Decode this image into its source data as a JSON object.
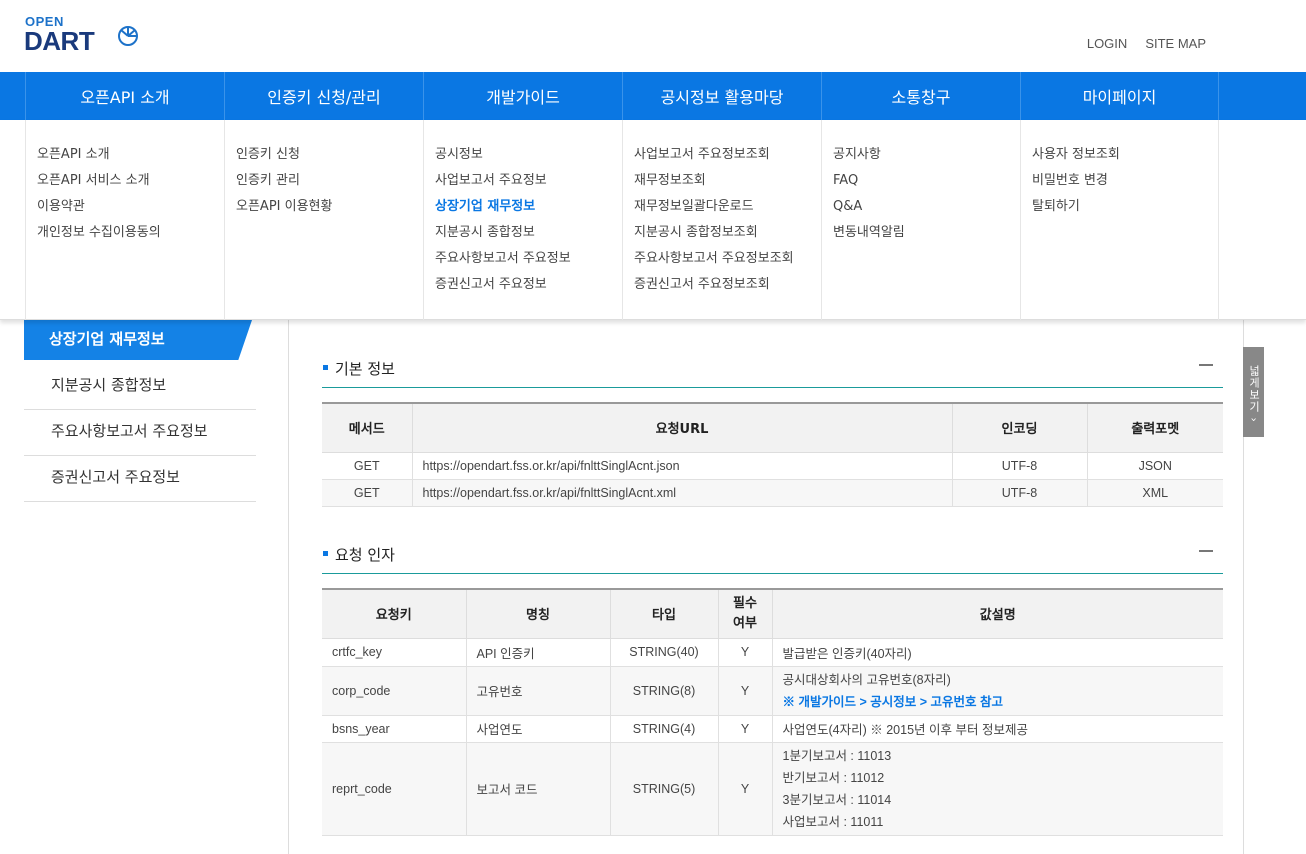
{
  "logo": {
    "top": "OPEN",
    "main": "DART"
  },
  "util": {
    "login": "LOGIN",
    "sitemap": "SITE MAP"
  },
  "gnb": [
    "오픈API 소개",
    "인증키 신청/관리",
    "개발가이드",
    "공시정보 활용마당",
    "소통창구",
    "마이페이지"
  ],
  "mega": [
    [
      "오픈API 소개",
      "오픈API 서비스 소개",
      "이용약관",
      "개인정보 수집이용동의"
    ],
    [
      "인증키 신청",
      "인증키 관리",
      "오픈API 이용현황"
    ],
    [
      "공시정보",
      "사업보고서 주요정보",
      "상장기업 재무정보",
      "지분공시 종합정보",
      "주요사항보고서 주요정보",
      "증권신고서 주요정보"
    ],
    [
      "사업보고서 주요정보조회",
      "재무정보조회",
      "재무정보일괄다운로드",
      "지분공시 종합정보조회",
      "주요사항보고서 주요정보조회",
      "증권신고서 주요정보조회"
    ],
    [
      "공지사항",
      "FAQ",
      "Q&A",
      "변동내역알림"
    ],
    [
      "사용자 정보조회",
      "비밀번호 변경",
      "탈퇴하기"
    ]
  ],
  "lnb": {
    "active": "상장기업 재무정보",
    "items": [
      "지분공시 종합정보",
      "주요사항보고서 주요정보",
      "증권신고서 주요정보"
    ]
  },
  "wide_button": "넓게보기 ›",
  "basic": {
    "title": "기본 정보",
    "headers": [
      "메서드",
      "요청URL",
      "인코딩",
      "출력포멧"
    ],
    "rows": [
      [
        "GET",
        "https://opendart.fss.or.kr/api/fnlttSinglAcnt.json",
        "UTF-8",
        "JSON"
      ],
      [
        "GET",
        "https://opendart.fss.or.kr/api/fnlttSinglAcnt.xml",
        "UTF-8",
        "XML"
      ]
    ]
  },
  "params": {
    "title": "요청 인자",
    "headers": [
      "요청키",
      "명칭",
      "타입",
      "필수\n여부",
      "값설명"
    ],
    "rows": [
      {
        "key": "crtfc_key",
        "name": "API 인증키",
        "type": "STRING(40)",
        "req": "Y",
        "desc": [
          "발급받은 인증키(40자리)"
        ]
      },
      {
        "key": "corp_code",
        "name": "고유번호",
        "type": "STRING(8)",
        "req": "Y",
        "desc": [
          "공시대상회사의 고유번호(8자리)"
        ],
        "ref": "※ 개발가이드 > 공시정보 > 고유번호 참고"
      },
      {
        "key": "bsns_year",
        "name": "사업연도",
        "type": "STRING(4)",
        "req": "Y",
        "desc": [
          "사업연도(4자리) ※ 2015년 이후 부터 정보제공"
        ]
      },
      {
        "key": "reprt_code",
        "name": "보고서 코드",
        "type": "STRING(5)",
        "req": "Y",
        "desc": [
          "1분기보고서 : 11013",
          "반기보고서 : 11012",
          "3분기보고서 : 11014",
          "사업보고서 : 11011"
        ]
      }
    ]
  }
}
